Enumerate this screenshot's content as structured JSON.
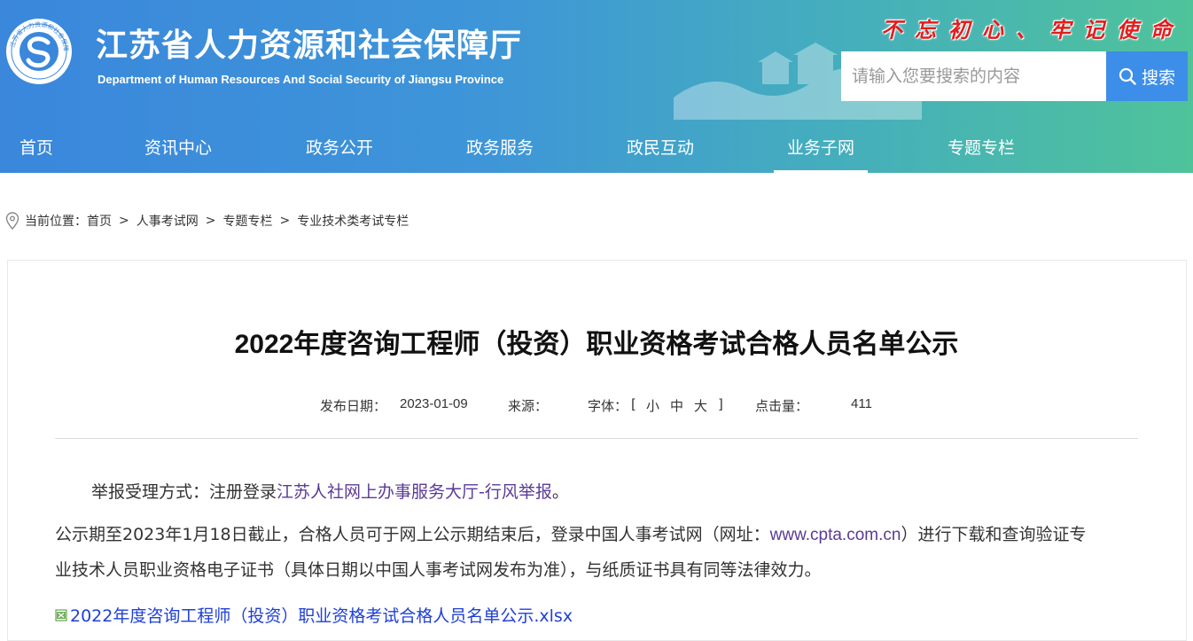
{
  "header": {
    "site_title": "江苏省人力资源和社会保障厅",
    "site_subtitle": "Department of Human Resources And Social Security of Jiangsu Province",
    "slogan": "不忘初心、牢记使命",
    "logo_ring_text": "江苏省人力资源和社会保障厅",
    "search": {
      "placeholder": "请输入您要搜索的内容",
      "button_label": "搜索"
    }
  },
  "nav": {
    "items": [
      {
        "label": "首页"
      },
      {
        "label": "资讯中心"
      },
      {
        "label": "政务公开"
      },
      {
        "label": "政务服务"
      },
      {
        "label": "政民互动"
      },
      {
        "label": "业务子网",
        "active": true
      },
      {
        "label": "专题专栏"
      }
    ]
  },
  "breadcrumb": {
    "prefix": "当前位置：",
    "items": [
      "首页",
      "人事考试网",
      "专题专栏",
      "专业技术类考试专栏"
    ],
    "separator": ">"
  },
  "article": {
    "title": "2022年度咨询工程师（投资）职业资格考试合格人员名单公示",
    "meta": {
      "date_label": "发布日期：",
      "date_value": "2023-01-09",
      "source_label": "来源：",
      "font_label": "字体：",
      "font_open": "[",
      "font_small": "小",
      "font_medium": "中",
      "font_large": "大",
      "font_close": "]",
      "views_label": "点击量：",
      "views_value": "411"
    },
    "report": {
      "prefix": "举报受理方式：注册登录",
      "link_text": "江苏人社网上办事服务大厅-行风举报",
      "suffix": "。"
    },
    "notice": {
      "line1_a": "公示期至2023年1月18日截止，合格人员可于网上公示期结束后，登录中国人事考试网（网址：",
      "line1_link": "www.cpta.com.cn",
      "line1_b": "）进行下载和查询验证专",
      "line2": "业技术人员职业资格电子证书（具体日期以中国人事考试网发布为准），与纸质证书具有同等法律效力。"
    },
    "attachment": {
      "label": "2022年度咨询工程师（投资）职业资格考试合格人员名单公示.xlsx",
      "icon": "excel-file-icon"
    }
  },
  "colors": {
    "header_start": "#3a87dc",
    "header_end": "#4fc39a",
    "slogan": "#e21d1d",
    "search_button": "#3d8ee8",
    "link_purple": "#5b3a96",
    "link_blue": "#1f3fd6"
  }
}
